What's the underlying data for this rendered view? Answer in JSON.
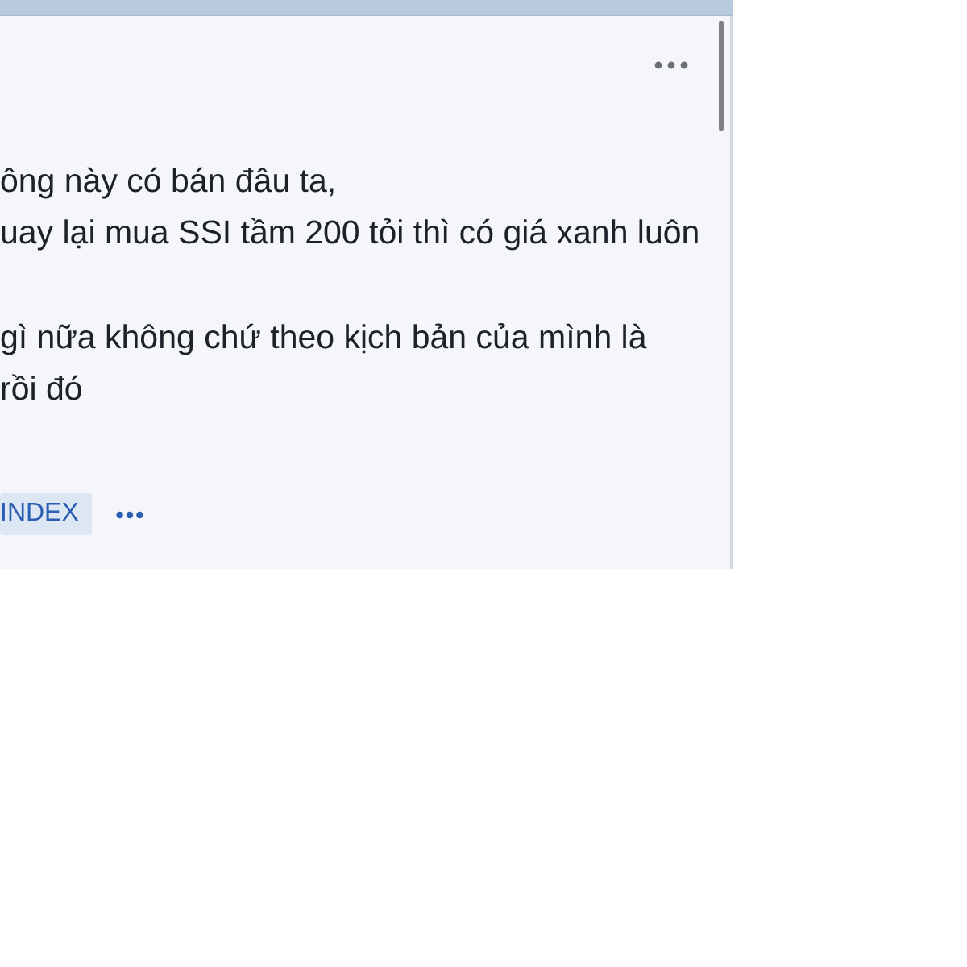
{
  "post": {
    "paragraphs": [
      "ông này có bán đâu ta,\nuay lại mua SSI tầm 200 tỏi thì có giá xanh luôn",
      "gì nữa không chứ theo kịch bản của mình là\nrồi đó"
    ],
    "tags": [
      {
        "label": "INDEX"
      }
    ]
  }
}
